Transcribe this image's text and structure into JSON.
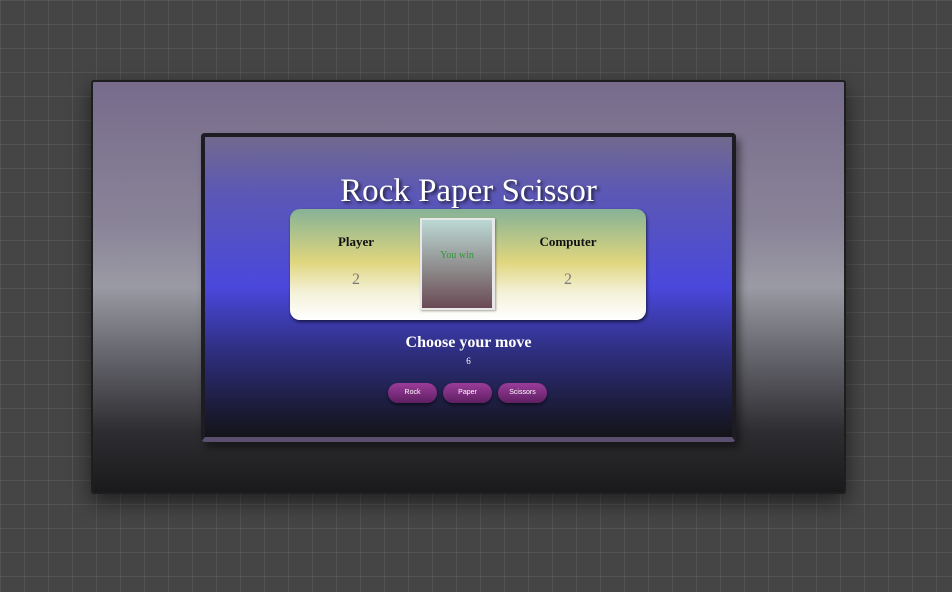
{
  "game": {
    "title": "Rock Paper Scissor",
    "scoreboard": {
      "player_label": "Player",
      "computer_label": "Computer",
      "player_score": "2",
      "computer_score": "2",
      "result": "You win"
    },
    "choose_heading": "Choose your move",
    "moves_left": "6",
    "moves": [
      {
        "label": "Rock"
      },
      {
        "label": "Paper"
      },
      {
        "label": "Scissors"
      }
    ]
  },
  "colors": {
    "background": "#454545",
    "panel_accent": "#4a48dc",
    "button": "#7a2c7c",
    "result_text": "#2f9a32"
  }
}
